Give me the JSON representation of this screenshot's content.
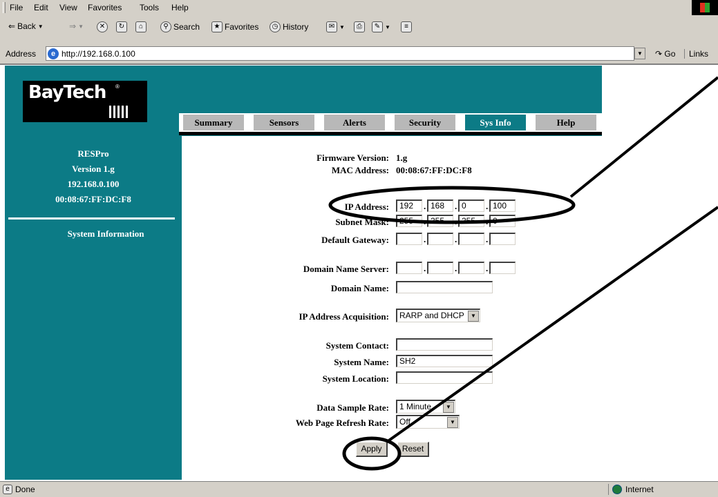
{
  "browser": {
    "menu": [
      "File",
      "Edit",
      "View",
      "Favorites",
      "Tools",
      "Help"
    ],
    "toolbar": {
      "back": "Back",
      "search": "Search",
      "favorites": "Favorites",
      "history": "History"
    },
    "address_label": "Address",
    "url": "http://192.168.0.100",
    "go": "Go",
    "links": "Links"
  },
  "logo": {
    "text": "BayTech",
    "tm": "®"
  },
  "tabs": [
    "Summary",
    "Sensors",
    "Alerts",
    "Security",
    "Sys Info",
    "Help"
  ],
  "active_tab": "Sys Info",
  "sidebar": {
    "product": "RESPro",
    "version": "Version 1.g",
    "ip": "192.168.0.100",
    "mac": "00:08:67:FF:DC:F8",
    "link": "System Information"
  },
  "form": {
    "firmware_label": "Firmware Version:",
    "firmware_value": "1.g",
    "mac_label": "MAC Address:",
    "mac_value": "00:08:67:FF:DC:F8",
    "ip_label": "IP Address:",
    "ip": [
      "192",
      "168",
      "0",
      "100"
    ],
    "subnet_label": "Subnet Mask:",
    "subnet": [
      "255",
      "255",
      "255",
      "0"
    ],
    "gateway_label": "Default Gateway:",
    "gateway": [
      "",
      "",
      "",
      ""
    ],
    "dns_label": "Domain Name Server:",
    "dns": [
      "",
      "",
      "",
      ""
    ],
    "domain_label": "Domain Name:",
    "domain": "",
    "acq_label": "IP Address Acquisition:",
    "acq": "RARP and DHCP",
    "contact_label": "System Contact:",
    "contact": "",
    "name_label": "System Name:",
    "name": "SH2",
    "location_label": "System Location:",
    "location": "",
    "sample_label": "Data Sample Rate:",
    "sample": "1 Minute",
    "refresh_label": "Web Page Refresh Rate:",
    "refresh": "Off",
    "apply": "Apply",
    "reset": "Reset"
  },
  "status": {
    "left": "Done",
    "zone": "Internet"
  }
}
